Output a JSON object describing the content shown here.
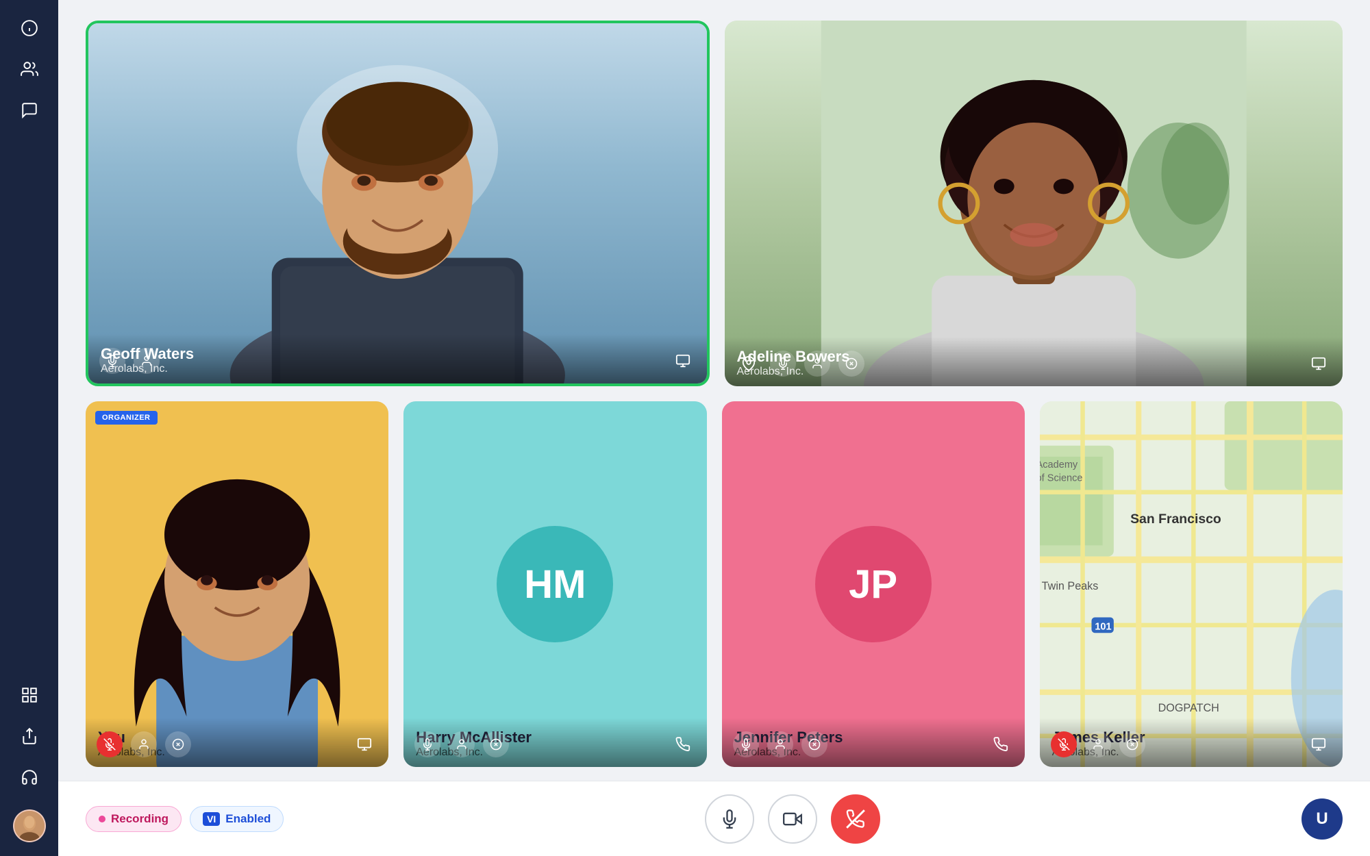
{
  "sidebar": {
    "icons": [
      "info",
      "users",
      "chat",
      "grid",
      "share",
      "headset"
    ],
    "avatar_initials": "U"
  },
  "participants": {
    "top_left": {
      "name": "Geoff Waters",
      "company": "Aerolabs, Inc.",
      "active_speaker": true,
      "photo_type": "geoff",
      "controls": [
        "mic",
        "user",
        "monitor"
      ]
    },
    "top_right": {
      "name": "Adeline Bowers",
      "company": "Aerolabs, Inc.",
      "active_speaker": false,
      "photo_type": "adeline",
      "controls": [
        "pin",
        "mic",
        "user",
        "close",
        "monitor"
      ]
    },
    "bottom_1": {
      "name": "You",
      "company": "Aerolabs, Inc.",
      "organizer": true,
      "photo_type": "you",
      "controls_muted": true
    },
    "bottom_2": {
      "name": "Harry McAllister",
      "company": "Aerolabs, Inc.",
      "initials": "HM",
      "bg_color": "#7dd8d8",
      "circle_color": "#3ab8b8"
    },
    "bottom_3": {
      "name": "Jennifer Peters",
      "company": "Aerolabs, Inc.",
      "initials": "JP",
      "bg_color": "#f07090",
      "circle_color": "#e04870"
    },
    "bottom_4": {
      "name": "James Keller",
      "company": "Aerolabs, Inc.",
      "photo_type": "map"
    }
  },
  "status_bar": {
    "recording_label": "Recording",
    "vi_prefix": "VI",
    "vi_label": "Enabled"
  },
  "controls": {
    "mic_label": "Microphone",
    "camera_label": "Camera",
    "end_call_label": "End Call"
  },
  "organizer_badge": "ORGANIZER",
  "corner_logo": "U"
}
